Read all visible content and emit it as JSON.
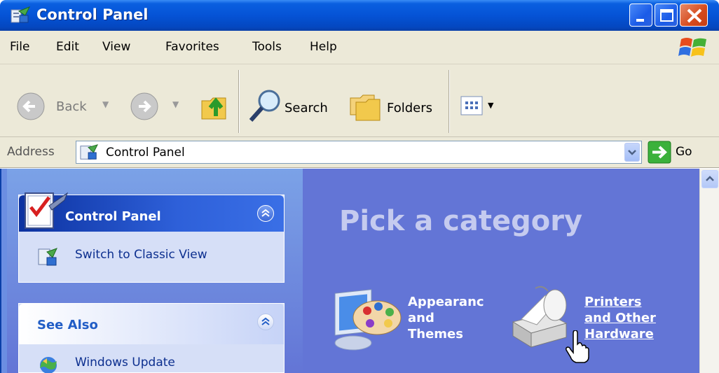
{
  "window": {
    "title": "Control Panel"
  },
  "menu": {
    "items": [
      "File",
      "Edit",
      "View",
      "Favorites",
      "Tools",
      "Help"
    ]
  },
  "toolbar": {
    "back_label": "Back",
    "search_label": "Search",
    "folders_label": "Folders"
  },
  "address": {
    "label": "Address",
    "value": "Control Panel",
    "go_label": "Go"
  },
  "sidebar": {
    "panel1": {
      "title": "Control Panel",
      "link": "Switch to Classic View"
    },
    "panel2": {
      "title": "See Also",
      "link": "Windows Update"
    }
  },
  "main": {
    "heading": "Pick a category",
    "categories": [
      {
        "lines": [
          "Appearanc",
          "and",
          "Themes"
        ]
      },
      {
        "lines": [
          "Printers",
          "and Other",
          "Hardware"
        ]
      }
    ]
  },
  "colors": {
    "titlebar": "#0553d6",
    "main_bg": "#6375d6",
    "menu_bg": "#ece9d8"
  }
}
